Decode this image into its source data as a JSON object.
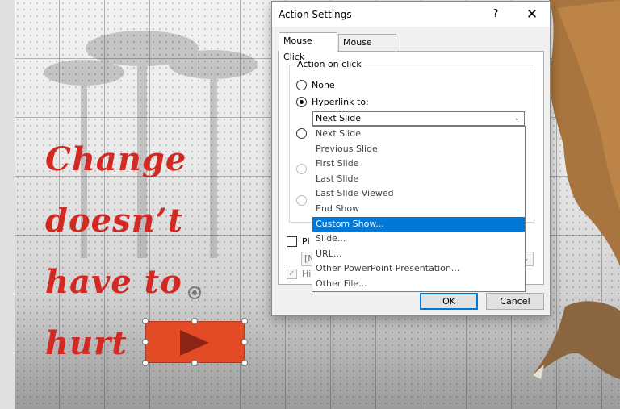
{
  "slide": {
    "text_lines": [
      "Change",
      "doesn’t",
      "have to",
      "hurt"
    ],
    "accent_color": "#d22a22",
    "button_color": "#e24b26"
  },
  "dialog": {
    "title": "Action Settings",
    "help_label": "?",
    "close_label": "✕",
    "tabs": [
      {
        "label": "Mouse Click",
        "active": true
      },
      {
        "label": "Mouse Over",
        "active": false
      }
    ],
    "group_label": "Action on click",
    "radios": {
      "none_label": "None",
      "hyperlink_label": "Hyperlink to:"
    },
    "hyperlink_combo": {
      "value": "Next Slide",
      "arrow": "⌄"
    },
    "dropdown_items": [
      "Next Slide",
      "Previous Slide",
      "First Slide",
      "Last Slide",
      "Last Slide Viewed",
      "End Show",
      "Custom Show...",
      "Slide...",
      "URL...",
      "Other PowerPoint Presentation...",
      "Other File..."
    ],
    "selected_item": "Custom Show...",
    "play_sound_partial": "Pl",
    "sound_combo_partial": "[N",
    "highlight_partial": "Hi",
    "ok_label": "OK",
    "cancel_label": "Cancel"
  }
}
